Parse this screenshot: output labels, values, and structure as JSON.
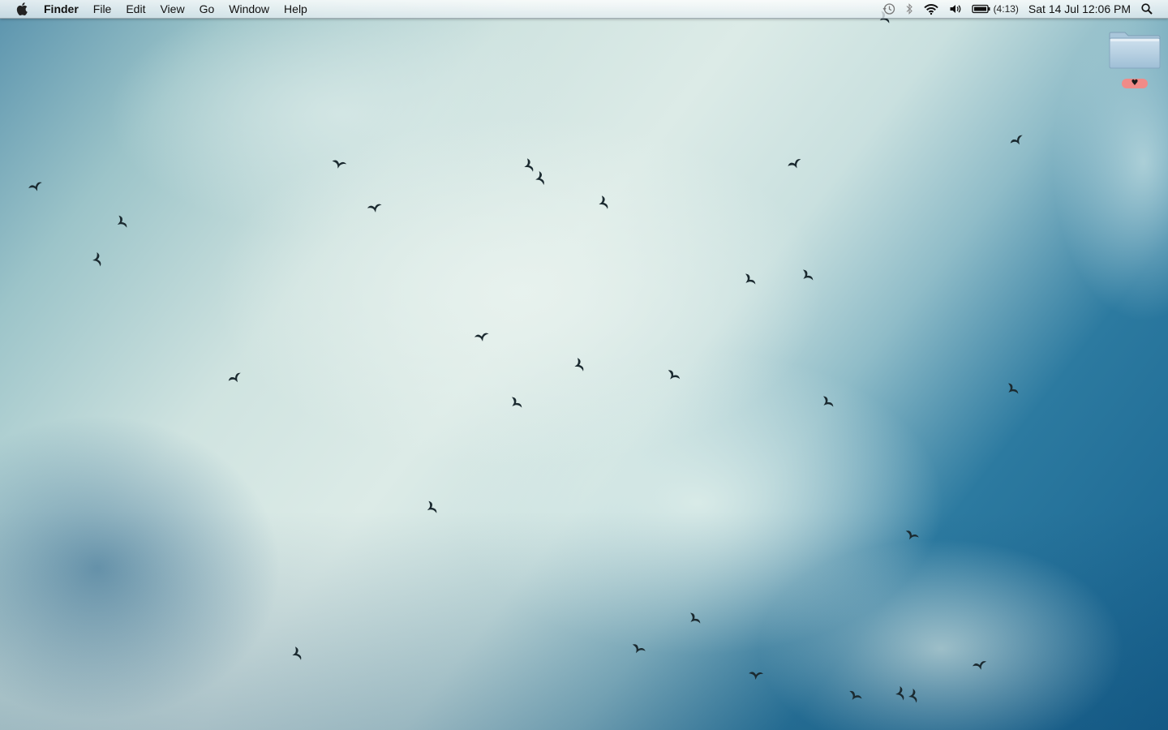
{
  "menubar": {
    "app_name": "Finder",
    "menus": [
      "File",
      "Edit",
      "View",
      "Go",
      "Window",
      "Help"
    ],
    "status": {
      "time_machine_icon": "clock-arrow-icon",
      "bluetooth_icon": "bluetooth-icon",
      "wifi_icon": "wifi-icon",
      "volume_icon": "speaker-icon",
      "battery_icon": "battery-icon",
      "battery_time": "(4:13)",
      "date_time": "Sat 14 Jul  12:06 PM",
      "spotlight_icon": "search-icon"
    }
  },
  "desktop": {
    "wallpaper": "sky-with-birds",
    "folder": {
      "icon": "folder-icon",
      "label": "♥",
      "label_color": "#f08b88"
    }
  },
  "colors": {
    "sky_deep": "#17628f",
    "cloud": "#dcebe7",
    "bird": "#1b2a30"
  }
}
